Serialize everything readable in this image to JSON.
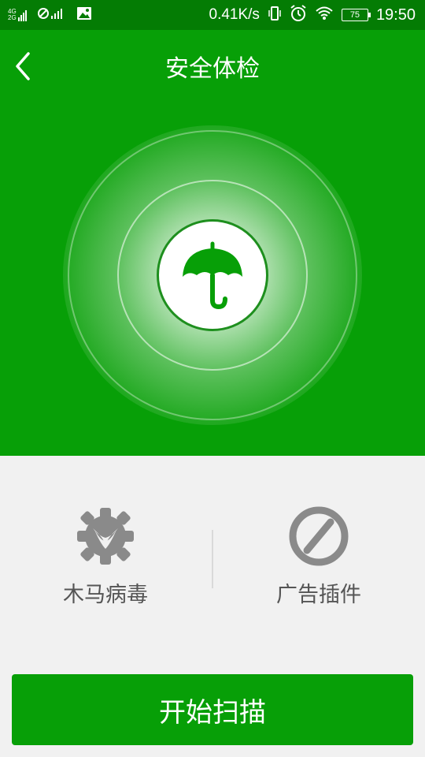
{
  "status_bar": {
    "network_top": "4G",
    "network_bottom": "2G",
    "speed": "0.41K/s",
    "battery": "75",
    "time": "19:50"
  },
  "header": {
    "title": "安全体检",
    "back_icon": "chevron-left-icon"
  },
  "center_icon": "umbrella-icon",
  "options": [
    {
      "label": "木马病毒",
      "icon": "virus-gear-icon"
    },
    {
      "label": "广告插件",
      "icon": "block-icon"
    }
  ],
  "start_button": {
    "label": "开始扫描"
  },
  "colors": {
    "primary": "#079f07",
    "status_bar": "#047c04",
    "background": "#f1f1f1",
    "icon_gray": "#8a8a8a",
    "label_gray": "#555555"
  }
}
